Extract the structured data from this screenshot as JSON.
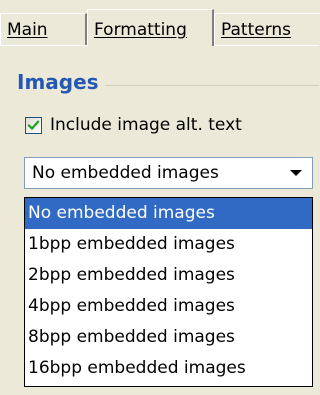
{
  "tabs": [
    {
      "label": "Main",
      "active": false
    },
    {
      "label": "Formatting",
      "active": true
    },
    {
      "label": "Patterns",
      "active": false
    }
  ],
  "images_group": {
    "title": "Images",
    "checkbox": {
      "label": "Include image alt. text",
      "checked": true
    },
    "combo": {
      "value": "No embedded images"
    },
    "options": [
      "No embedded images",
      "1bpp embedded images",
      "2bpp embedded images",
      "4bpp embedded images",
      "8bpp embedded images",
      "16bpp embedded images"
    ],
    "highlighted_option": "No embedded images"
  },
  "colors": {
    "background": "#ece9d8",
    "group_title": "#2458b2",
    "selection": "#316ac5",
    "check_mark": "#21a121"
  },
  "icons": {
    "check": "check-icon",
    "dropdown": "chevron-down-icon"
  }
}
